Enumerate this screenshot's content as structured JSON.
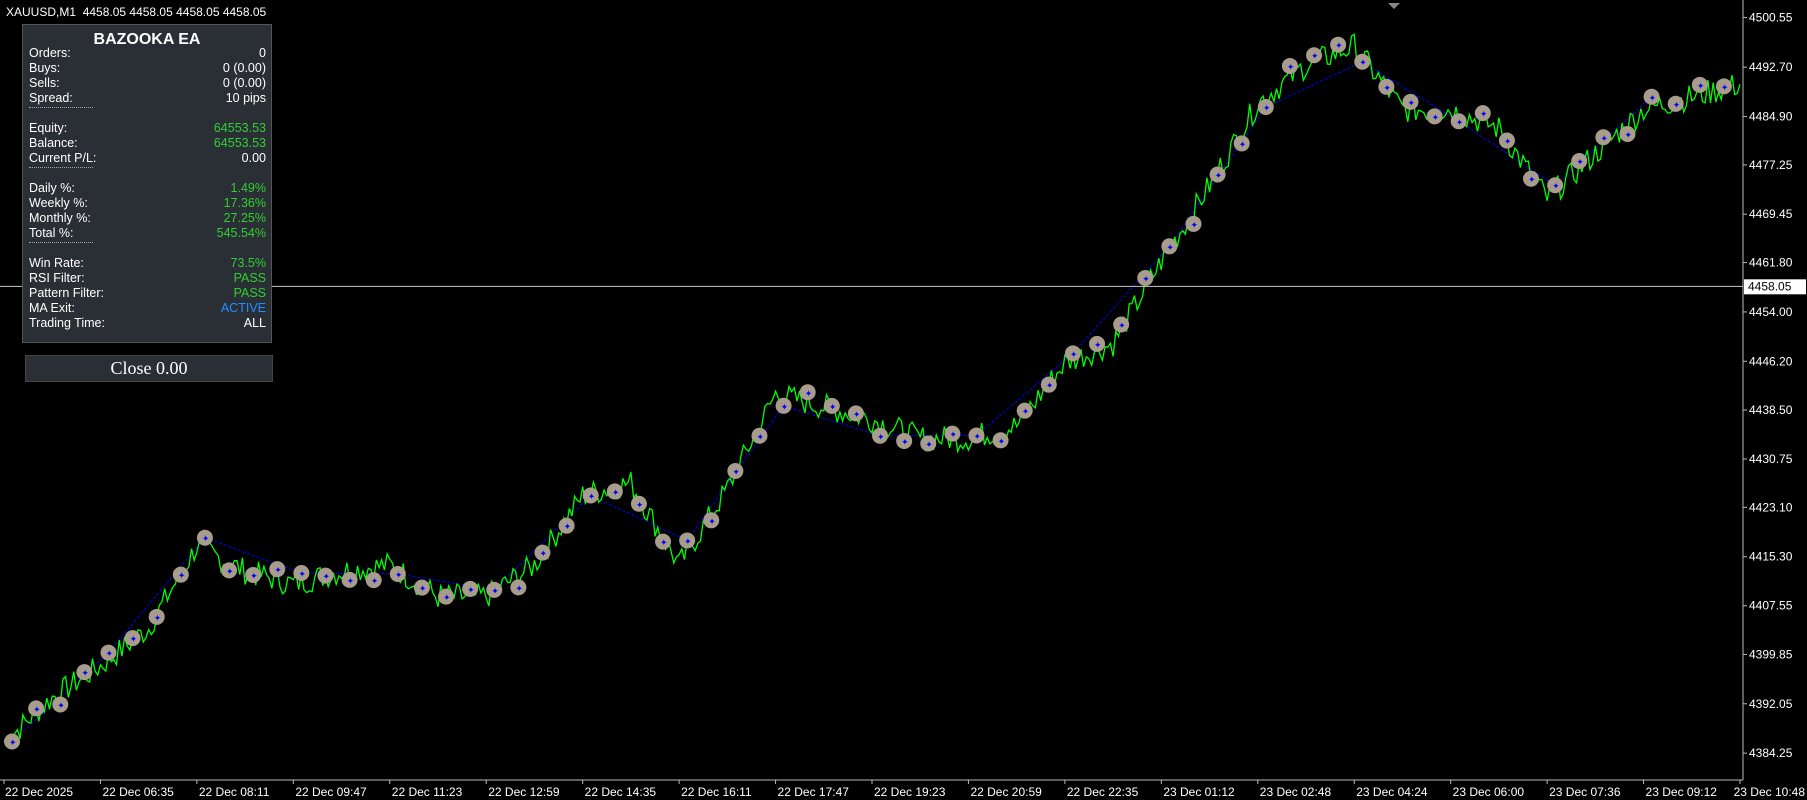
{
  "header": {
    "symbol": "XAUUSD,M1",
    "ohlc": "4458.05 4458.05 4458.05 4458.05"
  },
  "panel": {
    "title": "BAZOOKA EA",
    "rows": [
      {
        "label": "Orders:",
        "value": "0",
        "color": "#ffffff"
      },
      {
        "label": "Buys:",
        "value": "0 (0.00)",
        "color": "#ffffff"
      },
      {
        "label": "Sells:",
        "value": "0 (0.00)",
        "color": "#ffffff"
      },
      {
        "label": "Spread:",
        "value": "10 pips",
        "color": "#ffffff"
      },
      {
        "label": "Equity:",
        "value": "64553.53",
        "color": "#32cd32"
      },
      {
        "label": "Balance:",
        "value": "64553.53",
        "color": "#32cd32"
      },
      {
        "label": "Current P/L:",
        "value": "0.00",
        "color": "#ffffff"
      },
      {
        "label": "Daily %:",
        "value": "1.49%",
        "color": "#32cd32"
      },
      {
        "label": "Weekly %:",
        "value": "17.36%",
        "color": "#32cd32"
      },
      {
        "label": "Monthly %:",
        "value": "27.25%",
        "color": "#32cd32"
      },
      {
        "label": "Total %:",
        "value": "545.54%",
        "color": "#32cd32"
      },
      {
        "label": "Win Rate:",
        "value": "73.5%",
        "color": "#32cd32"
      },
      {
        "label": "RSI Filter:",
        "value": "PASS",
        "color": "#32cd32"
      },
      {
        "label": "Pattern Filter:",
        "value": "PASS",
        "color": "#32cd32"
      },
      {
        "label": "MA Exit:",
        "value": "ACTIVE",
        "color": "#1e90ff"
      },
      {
        "label": "Trading Time:",
        "value": "ALL",
        "color": "#ffffff"
      }
    ]
  },
  "close_button": {
    "label": "Close 0.00"
  },
  "chart_data": {
    "type": "line",
    "series": [
      {
        "x": [
          "22 Dec 2025 05:00",
          "22 Dec 2025 05:48",
          "22 Dec 2025 06:35",
          "22 Dec 2025 07:23",
          "22 Dec 2025 08:11",
          "22 Dec 2025 08:59",
          "22 Dec 2025 09:47",
          "22 Dec 2025 10:35",
          "22 Dec 2025 11:23",
          "22 Dec 2025 12:11",
          "22 Dec 2025 12:59",
          "22 Dec 2025 13:47",
          "22 Dec 2025 14:35",
          "22 Dec 2025 15:23",
          "22 Dec 2025 16:11",
          "22 Dec 2025 16:59",
          "22 Dec 2025 17:47",
          "22 Dec 2025 18:35",
          "22 Dec 2025 19:23",
          "22 Dec 2025 20:11",
          "22 Dec 2025 20:59",
          "22 Dec 2025 21:47",
          "22 Dec 2025 22:35",
          "22 Dec 2025 23:23",
          "23 Dec 2025 01:12",
          "23 Dec 2025 02:00",
          "23 Dec 2025 02:48",
          "23 Dec 2025 03:36",
          "23 Dec 2025 04:24",
          "23 Dec 2025 05:12",
          "23 Dec 2025 06:00",
          "23 Dec 2025 06:48",
          "23 Dec 2025 07:36",
          "23 Dec 2025 08:24",
          "23 Dec 2025 09:12",
          "23 Dec 2025 10:00",
          "23 Dec 2025 10:48"
        ],
        "values": [
          4386,
          4393,
          4398,
          4404,
          4417,
          4413,
          4411,
          4413,
          4414,
          4409,
          4409,
          4414,
          4425,
          4427,
          4414,
          4426,
          4441,
          4439,
          4437,
          4434,
          4434,
          4436,
          4446,
          4449,
          4462,
          4474,
          4487,
          4493,
          4496,
          4486,
          4486,
          4483,
          4472,
          4479,
          4486,
          4488,
          4490
        ]
      }
    ],
    "y_axis": {
      "ticks": [
        "4500.55",
        "4492.70",
        "4484.90",
        "4477.25",
        "4469.45",
        "4461.80",
        "4454.00",
        "4446.20",
        "4438.50",
        "4430.75",
        "4423.10",
        "4415.30",
        "4407.55",
        "4399.85",
        "4392.05",
        "4384.25"
      ],
      "range": [
        4380,
        4503
      ],
      "current_price": "4458.05"
    },
    "x_axis": {
      "ticks": [
        "22 Dec 2025",
        "22 Dec 06:35",
        "22 Dec 08:11",
        "22 Dec 09:47",
        "22 Dec 11:23",
        "22 Dec 12:59",
        "22 Dec 14:35",
        "22 Dec 16:11",
        "22 Dec 17:47",
        "22 Dec 19:23",
        "22 Dec 20:59",
        "22 Dec 22:35",
        "23 Dec 01:12",
        "23 Dec 02:48",
        "23 Dec 04:24",
        "23 Dec 06:00",
        "23 Dec 07:36",
        "23 Dec 09:12",
        "23 Dec 10:48"
      ]
    },
    "colors": {
      "price_line": "#00ff00",
      "background": "#000000",
      "trade_lines": "#0000ff",
      "trade_marker": "#a89d8c",
      "axis_text": "#ffffff",
      "current_price_line": "#c8c8c8"
    },
    "grid": false,
    "trade_markers": true
  }
}
